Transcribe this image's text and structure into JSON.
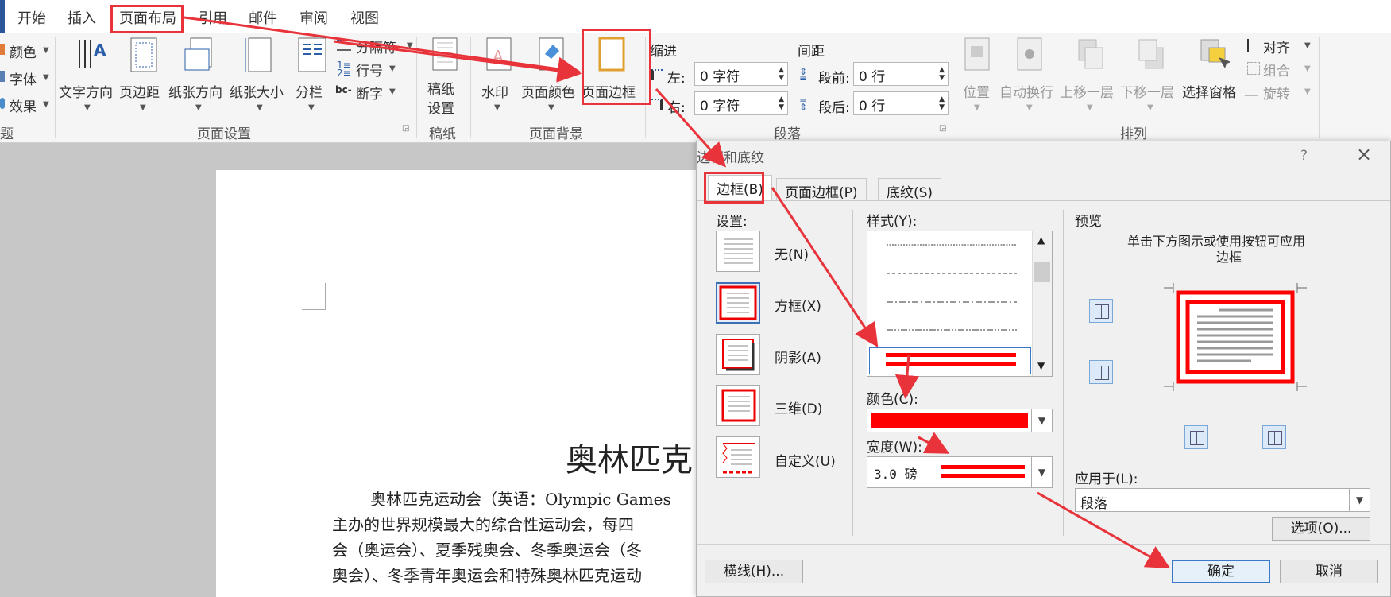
{
  "ribbon_tabs": [
    "开始",
    "插入",
    "页面布局",
    "引用",
    "邮件",
    "审阅",
    "视图"
  ],
  "theme": {
    "colors": "颜色",
    "fonts": "字体",
    "effects": "效果",
    "group_label_partial": "题"
  },
  "page_setup": {
    "text_direction": "文字方向",
    "margins": "页边距",
    "orientation": "纸张方向",
    "size": "纸张大小",
    "columns": "分栏",
    "breaks": "分隔符",
    "line_numbers": "行号",
    "hyphenation": "断字",
    "group_label": "页面设置"
  },
  "manuscript": {
    "btn_line1": "稿纸",
    "btn_line2": "设置",
    "group_label": "稿纸"
  },
  "page_background": {
    "watermark": "水印",
    "page_color": "页面颜色",
    "page_borders": "页面边框",
    "group_label": "页面背景"
  },
  "paragraph": {
    "indent_title": "缩进",
    "left_label": "左:",
    "left_value": "0 字符",
    "right_label": "右:",
    "right_value": "0 字符",
    "spacing_title": "间距",
    "before_label": "段前:",
    "before_value": "0 行",
    "after_label": "段后:",
    "after_value": "0 行",
    "group_label": "段落"
  },
  "arrange": {
    "position": "位置",
    "wrap": "自动换行",
    "bring_forward": "上移一层",
    "send_backward": "下移一层",
    "selection_pane": "选择窗格",
    "align": "对齐",
    "group": "组合",
    "rotate": "旋转",
    "group_label": "排列"
  },
  "document": {
    "title_partial": "奥林匹克",
    "line1": "奥林匹克运动会（英语：Olympic Games",
    "line2": "主办的世界规模最大的综合性运动会，每四",
    "line3": "会（奥运会）、夏季残奥会、冬季奥运会（冬",
    "line4": "奥会）、冬季青年奥运会和特殊奥林匹克运动"
  },
  "dialog": {
    "title": "边框和底纹",
    "help": "?",
    "close": "×",
    "tabs": [
      "边框(B)",
      "页面边框(P)",
      "底纹(S)"
    ],
    "settings_label": "设置:",
    "settings": [
      "无(N)",
      "方框(X)",
      "阴影(A)",
      "三维(D)",
      "自定义(U)"
    ],
    "style_label": "样式(Y):",
    "color_label": "颜色(C):",
    "color_value": "#ff0000",
    "width_label": "宽度(W):",
    "width_value": "3.0 磅",
    "preview_label": "预览",
    "preview_hint_line1": "单击下方图示或使用按钮可应用",
    "preview_hint_line2": "边框",
    "apply_to_label": "应用于(L):",
    "apply_to_value": "段落",
    "options_button": "选项(O)...",
    "horizontal_line_button": "横线(H)...",
    "ok_button": "确定",
    "cancel_button": "取消"
  },
  "colors": {
    "accent_red": "#e8333a",
    "border_red": "#ff0000",
    "selection_blue": "#3c78c8"
  }
}
